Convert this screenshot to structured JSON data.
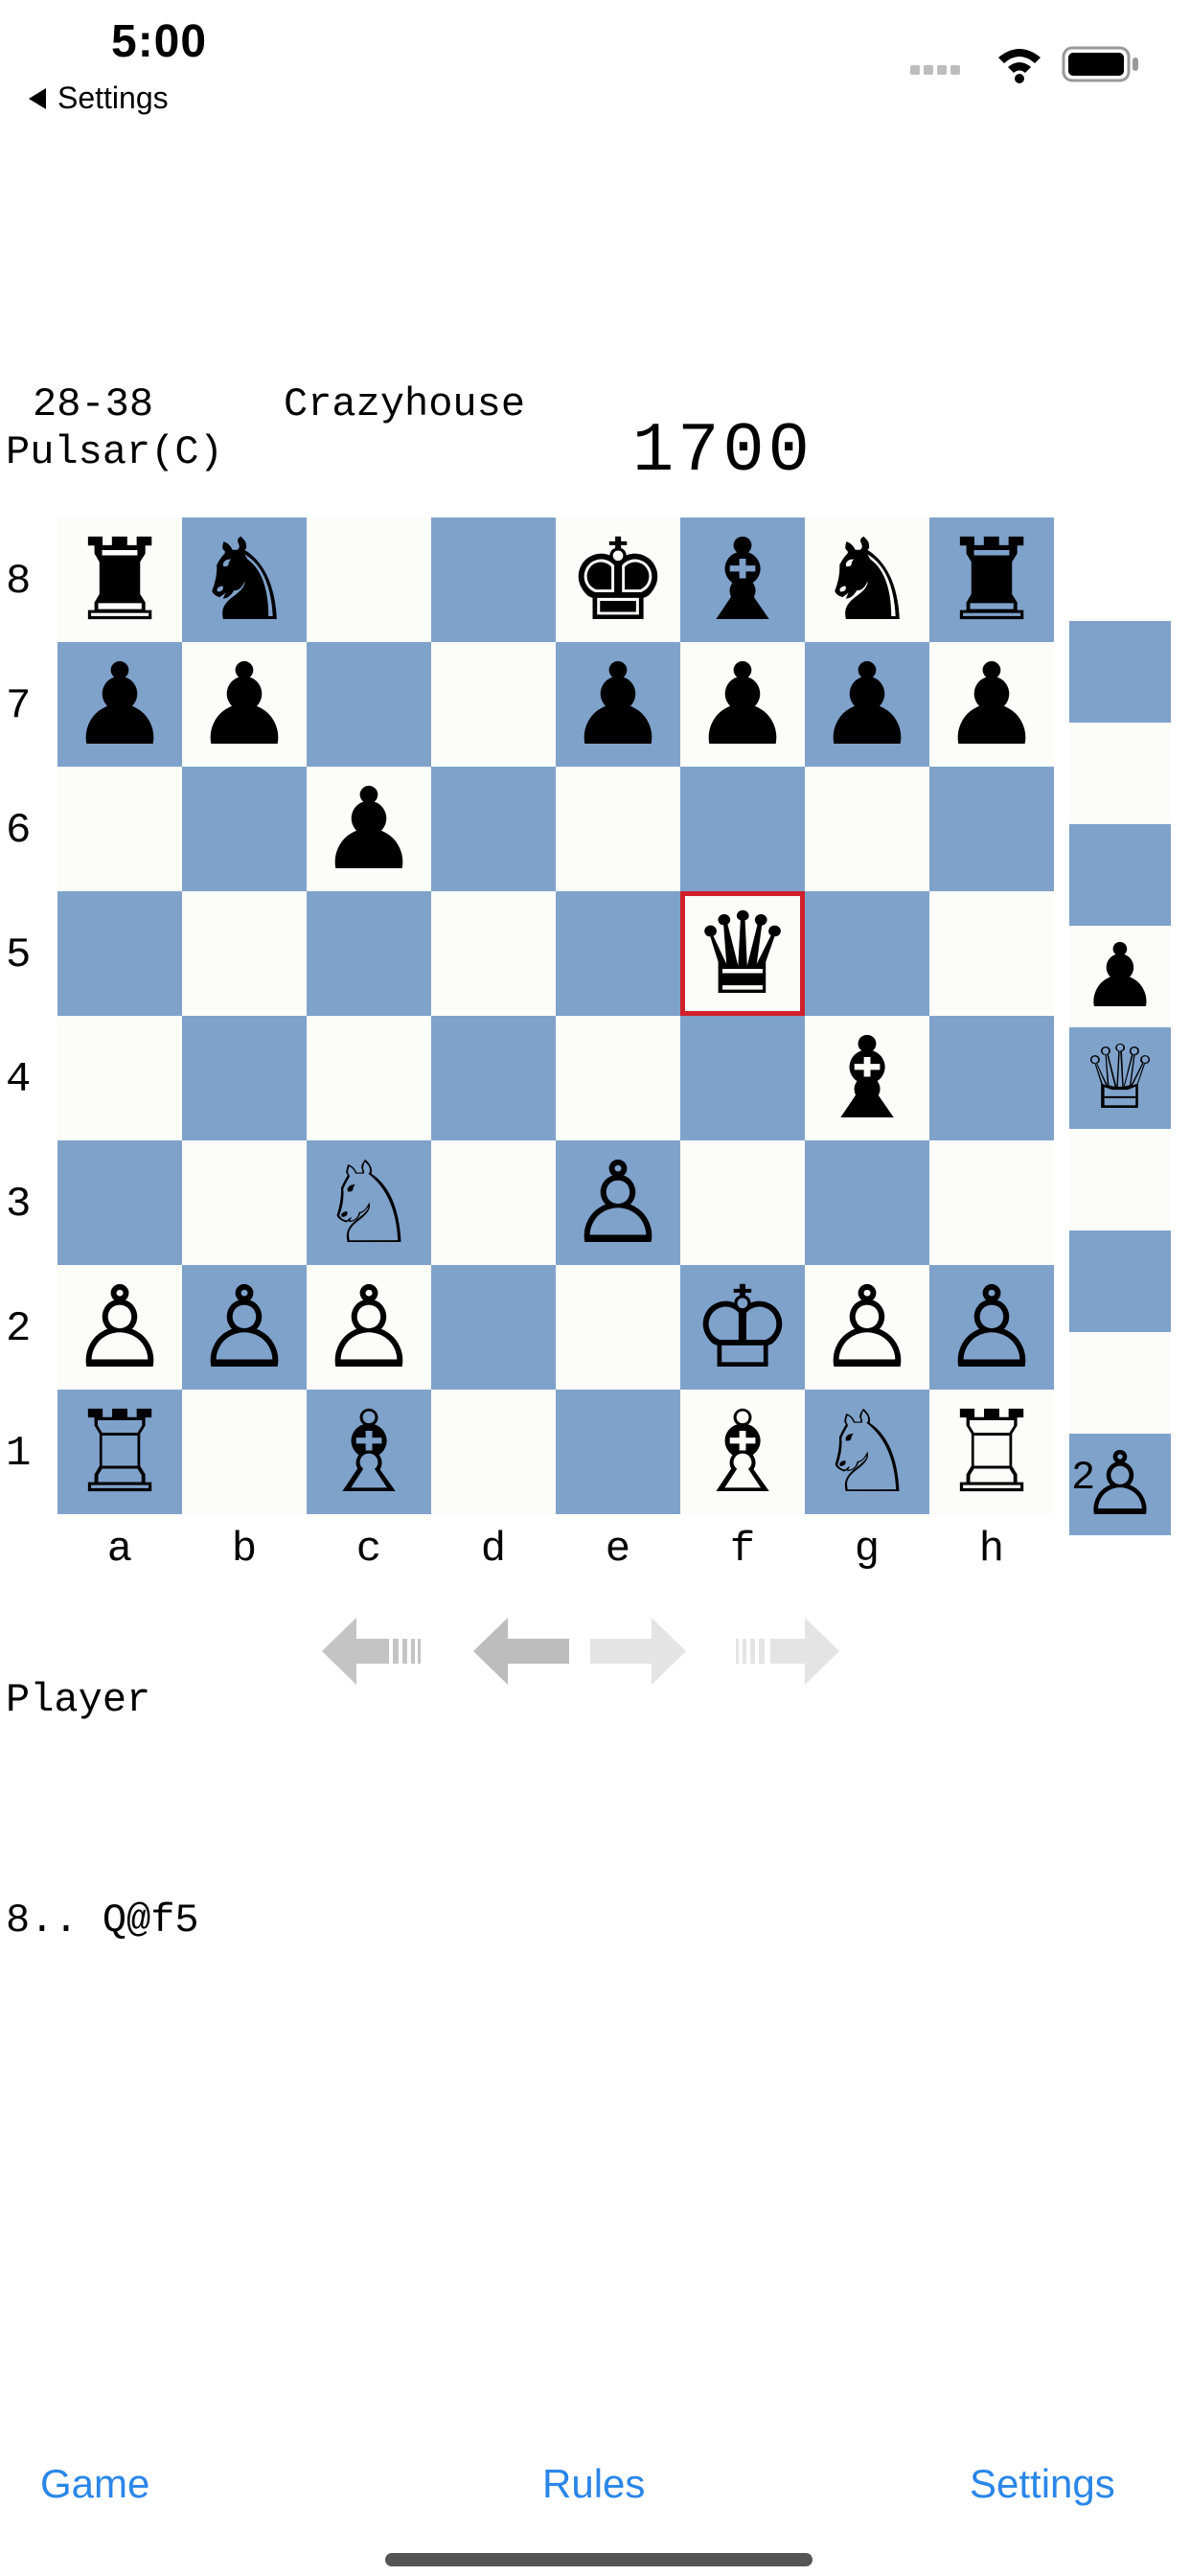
{
  "status_bar": {
    "time": "5:00",
    "back_label": "Settings",
    "icons": [
      "signal-dots-icon",
      "wifi-icon",
      "battery-icon"
    ]
  },
  "game": {
    "record": "28-38",
    "variant": "Crazyhouse",
    "opponent": "Pulsar(C)",
    "rating": "1700",
    "player": "Player",
    "last_move": "8.. Q@f5"
  },
  "board": {
    "files": [
      "a",
      "b",
      "c",
      "d",
      "e",
      "f",
      "g",
      "h"
    ],
    "ranks": [
      "8",
      "7",
      "6",
      "5",
      "4",
      "3",
      "2",
      "1"
    ],
    "highlight": "f5",
    "colors": {
      "light": "#fcfcf9",
      "dark": "#7fa2cb",
      "highlight": "#d0202a"
    },
    "pieces": [
      {
        "square": "a8",
        "piece": "♜",
        "side": "black",
        "name": "black-rook"
      },
      {
        "square": "b8",
        "piece": "♞",
        "side": "black",
        "name": "black-knight"
      },
      {
        "square": "e8",
        "piece": "♚",
        "side": "black",
        "name": "black-king"
      },
      {
        "square": "f8",
        "piece": "♝",
        "side": "black",
        "name": "black-bishop"
      },
      {
        "square": "g8",
        "piece": "♞",
        "side": "black",
        "name": "black-knight"
      },
      {
        "square": "h8",
        "piece": "♜",
        "side": "black",
        "name": "black-rook"
      },
      {
        "square": "a7",
        "piece": "♟",
        "side": "black",
        "name": "black-pawn"
      },
      {
        "square": "b7",
        "piece": "♟",
        "side": "black",
        "name": "black-pawn"
      },
      {
        "square": "e7",
        "piece": "♟",
        "side": "black",
        "name": "black-pawn"
      },
      {
        "square": "f7",
        "piece": "♟",
        "side": "black",
        "name": "black-pawn"
      },
      {
        "square": "g7",
        "piece": "♟",
        "side": "black",
        "name": "black-pawn"
      },
      {
        "square": "h7",
        "piece": "♟",
        "side": "black",
        "name": "black-pawn"
      },
      {
        "square": "c6",
        "piece": "♟",
        "side": "black",
        "name": "black-pawn"
      },
      {
        "square": "f5",
        "piece": "♛",
        "side": "black",
        "name": "black-queen"
      },
      {
        "square": "g4",
        "piece": "♝",
        "side": "black",
        "name": "black-bishop"
      },
      {
        "square": "c3",
        "piece": "♘",
        "side": "white",
        "name": "white-knight"
      },
      {
        "square": "e3",
        "piece": "♙",
        "side": "white",
        "name": "white-pawn"
      },
      {
        "square": "a2",
        "piece": "♙",
        "side": "white",
        "name": "white-pawn"
      },
      {
        "square": "b2",
        "piece": "♙",
        "side": "white",
        "name": "white-pawn"
      },
      {
        "square": "c2",
        "piece": "♙",
        "side": "white",
        "name": "white-pawn"
      },
      {
        "square": "f2",
        "piece": "♔",
        "side": "white",
        "name": "white-king"
      },
      {
        "square": "g2",
        "piece": "♙",
        "side": "white",
        "name": "white-pawn"
      },
      {
        "square": "h2",
        "piece": "♙",
        "side": "white",
        "name": "white-pawn"
      },
      {
        "square": "a1",
        "piece": "♖",
        "side": "white",
        "name": "white-rook"
      },
      {
        "square": "c1",
        "piece": "♗",
        "side": "white",
        "name": "white-bishop"
      },
      {
        "square": "f1",
        "piece": "♗",
        "side": "white",
        "name": "white-bishop"
      },
      {
        "square": "g1",
        "piece": "♘",
        "side": "white",
        "name": "white-knight"
      },
      {
        "square": "h1",
        "piece": "♖",
        "side": "white",
        "name": "white-rook"
      }
    ]
  },
  "pocket": {
    "black_pawn": "♟",
    "white_queen": "♕",
    "white_pawn": "♙",
    "white_pawn_count": "2"
  },
  "nav": [
    "first-move-arrow-icon",
    "prev-move-arrow-icon",
    "next-move-arrow-icon",
    "last-move-arrow-icon"
  ],
  "toolbar": {
    "game_label": "Game",
    "rules_label": "Rules",
    "settings_label": "Settings"
  }
}
